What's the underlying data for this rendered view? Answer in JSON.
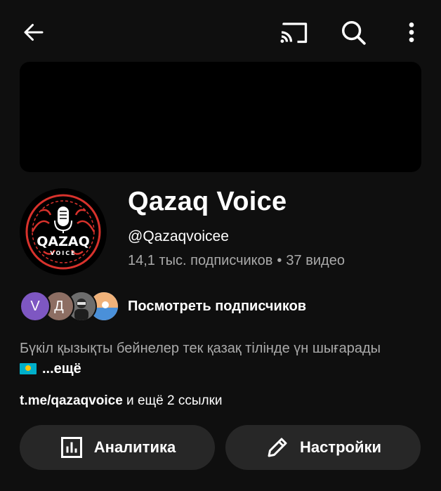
{
  "header": {
    "back_icon": "arrow-left-icon",
    "cast_icon": "cast-icon",
    "search_icon": "search-icon",
    "more_icon": "more-vert-icon"
  },
  "channel": {
    "title": "Qazaq Voice",
    "handle": "@Qazaqvoicee",
    "subscribers": "14,1 тыс. подписчиков",
    "separator": "•",
    "videos": "37 видео",
    "logo_text": "QAZAQ VOICE"
  },
  "subscribers_row": {
    "avatars": [
      "V",
      "Д"
    ],
    "label": "Посмотреть подписчиков"
  },
  "description": {
    "text": "Бүкіл қызықты бейнелер тек қазақ тілінде үн шығарады",
    "flag_icon": "kazakhstan-flag-icon",
    "more": "...ещё"
  },
  "links": {
    "url": "t.me/qazaqvoice",
    "more": " и ещё 2 ссылки"
  },
  "buttons": {
    "analytics": "Аналитика",
    "settings": "Настройки"
  },
  "colors": {
    "background": "#0f0f0f",
    "button_bg": "#272727",
    "secondary_text": "#aaaaaa",
    "logo_red": "#d8322c"
  }
}
